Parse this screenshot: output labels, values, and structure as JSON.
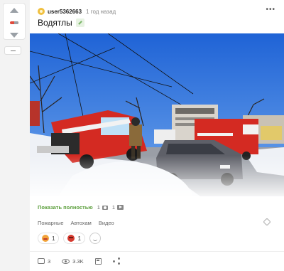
{
  "post": {
    "author": "user5362663",
    "time": "1 год назад",
    "title": "Водятлы",
    "show_full": "Показать полностью",
    "photo_count": "1",
    "video_count": "1",
    "tags": [
      "Пожарные",
      "Автохам",
      "Видео"
    ],
    "reactions": [
      {
        "icon": "laugh-emoji-icon",
        "count": "1"
      },
      {
        "icon": "angry-emoji-icon",
        "count": "1"
      }
    ],
    "comments": "3",
    "views": "3.3K"
  },
  "colors": {
    "accent_green": "#5a9e3a",
    "fire_truck_red": "#d42a22"
  }
}
